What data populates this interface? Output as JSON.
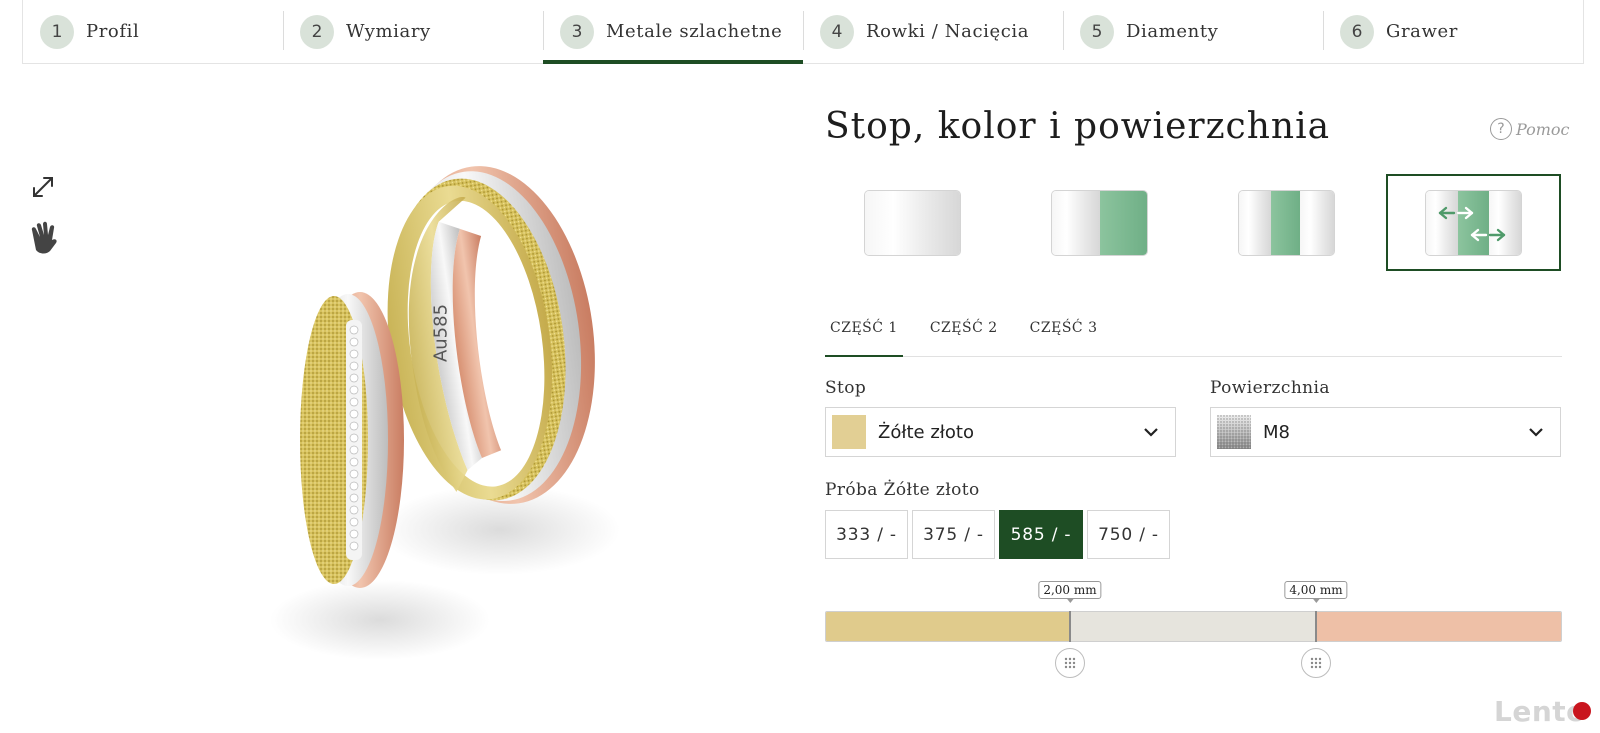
{
  "stepper": {
    "steps": [
      {
        "num": "1",
        "label": "Profil"
      },
      {
        "num": "2",
        "label": "Wymiary"
      },
      {
        "num": "3",
        "label": "Metale szlachetne"
      },
      {
        "num": "4",
        "label": "Rowki / Nacięcia"
      },
      {
        "num": "5",
        "label": "Diamenty"
      },
      {
        "num": "6",
        "label": "Grawer"
      }
    ],
    "active_step": 3
  },
  "product": {
    "engraving_text": "Au585"
  },
  "panel": {
    "title": "Stop, kolor i powierzchnia",
    "help_label": "Pomoc",
    "help_icon": "?",
    "variants": [
      "silver-single",
      "silver-green-split",
      "silver-green-silver",
      "tricolor-adjustable"
    ],
    "selected_variant": 4
  },
  "tabs": {
    "items": [
      "CZĘŚĆ 1",
      "CZĘŚĆ 2",
      "CZĘŚĆ 3"
    ],
    "active": 0
  },
  "alloy": {
    "label": "Stop",
    "value": "Żółte złoto",
    "swatch_color": "#e2cf94"
  },
  "surface": {
    "label": "Powierzchnia",
    "value": "M8"
  },
  "purity": {
    "label": "Próba Żółte złoto",
    "options": [
      "333 / -",
      "375 / -",
      "585 / -",
      "750 / -"
    ],
    "selected": 2
  },
  "width_bar": {
    "markers": [
      "2,00 mm",
      "4,00 mm"
    ],
    "segments": [
      {
        "color": "#e0cb8c",
        "fraction": 0.333
      },
      {
        "color": "#e6e4dd",
        "fraction": 0.334
      },
      {
        "color": "#eec0a7",
        "fraction": 0.333
      }
    ]
  },
  "watermark": {
    "text": "Lento",
    "dot": "pl"
  },
  "colors": {
    "accent": "#1e4d24",
    "step_circle": "#d9e2d9"
  }
}
